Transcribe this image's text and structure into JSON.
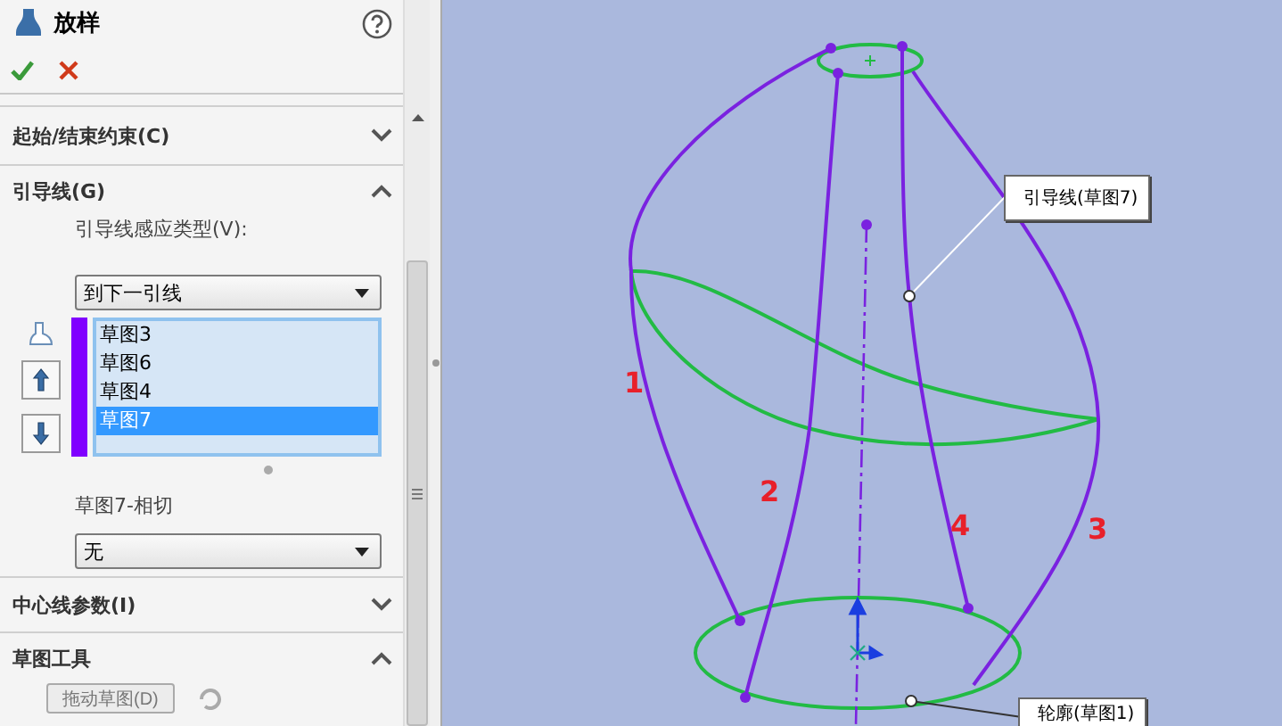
{
  "panel": {
    "title": "放样"
  },
  "start_end_constraints": {
    "title": "起始/结束约束(C)",
    "expanded": false
  },
  "guide_curves": {
    "title": "引导线(G)",
    "expanded": true,
    "influence_label": "引导线感应类型(V):",
    "influence_value": "到下一引线",
    "curves": [
      {
        "label": "草图3",
        "selected": false
      },
      {
        "label": "草图6",
        "selected": false
      },
      {
        "label": "草图4",
        "selected": false
      },
      {
        "label": "草图7",
        "selected": true
      }
    ],
    "tangency_label": "草图7-相切",
    "tangency_value": "无"
  },
  "centerline_params": {
    "title": "中心线参数(I)",
    "expanded": false
  },
  "sketch_tools": {
    "title": "草图工具",
    "expanded": true,
    "button": "拖动草图(D)"
  },
  "viewport": {
    "callouts": [
      {
        "text": "引导线(草图7)"
      },
      {
        "text": "轮廓(草图1)"
      }
    ],
    "curve_labels": [
      "1",
      "2",
      "4",
      "3"
    ]
  }
}
